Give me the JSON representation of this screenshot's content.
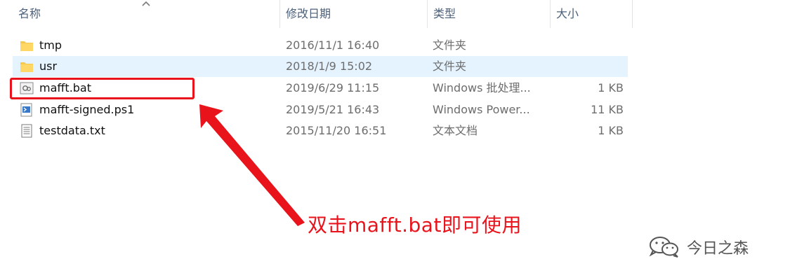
{
  "columns": {
    "name": "名称",
    "date": "修改日期",
    "type": "类型",
    "size": "大小"
  },
  "files": [
    {
      "name": "tmp",
      "date": "2016/11/1 16:40",
      "type": "文件夹",
      "size": "",
      "icon": "folder-icon"
    },
    {
      "name": "usr",
      "date": "2018/1/9 15:02",
      "type": "文件夹",
      "size": "",
      "icon": "folder-icon"
    },
    {
      "name": "mafft.bat",
      "date": "2019/6/29 11:15",
      "type": "Windows 批处理...",
      "size": "1 KB",
      "icon": "batch-file-icon"
    },
    {
      "name": "mafft-signed.ps1",
      "date": "2019/5/21 16:43",
      "type": "Windows Power...",
      "size": "11 KB",
      "icon": "powershell-script-icon"
    },
    {
      "name": "testdata.txt",
      "date": "2015/11/20 16:51",
      "type": "文本文档",
      "size": "1 KB",
      "icon": "text-file-icon"
    }
  ],
  "annotation": "双击mafft.bat即可使用",
  "watermark": "今日之森",
  "colors": {
    "accent_red": "#e8131b",
    "hover_row": "#e5f3ff",
    "header_text": "#4c607a"
  }
}
